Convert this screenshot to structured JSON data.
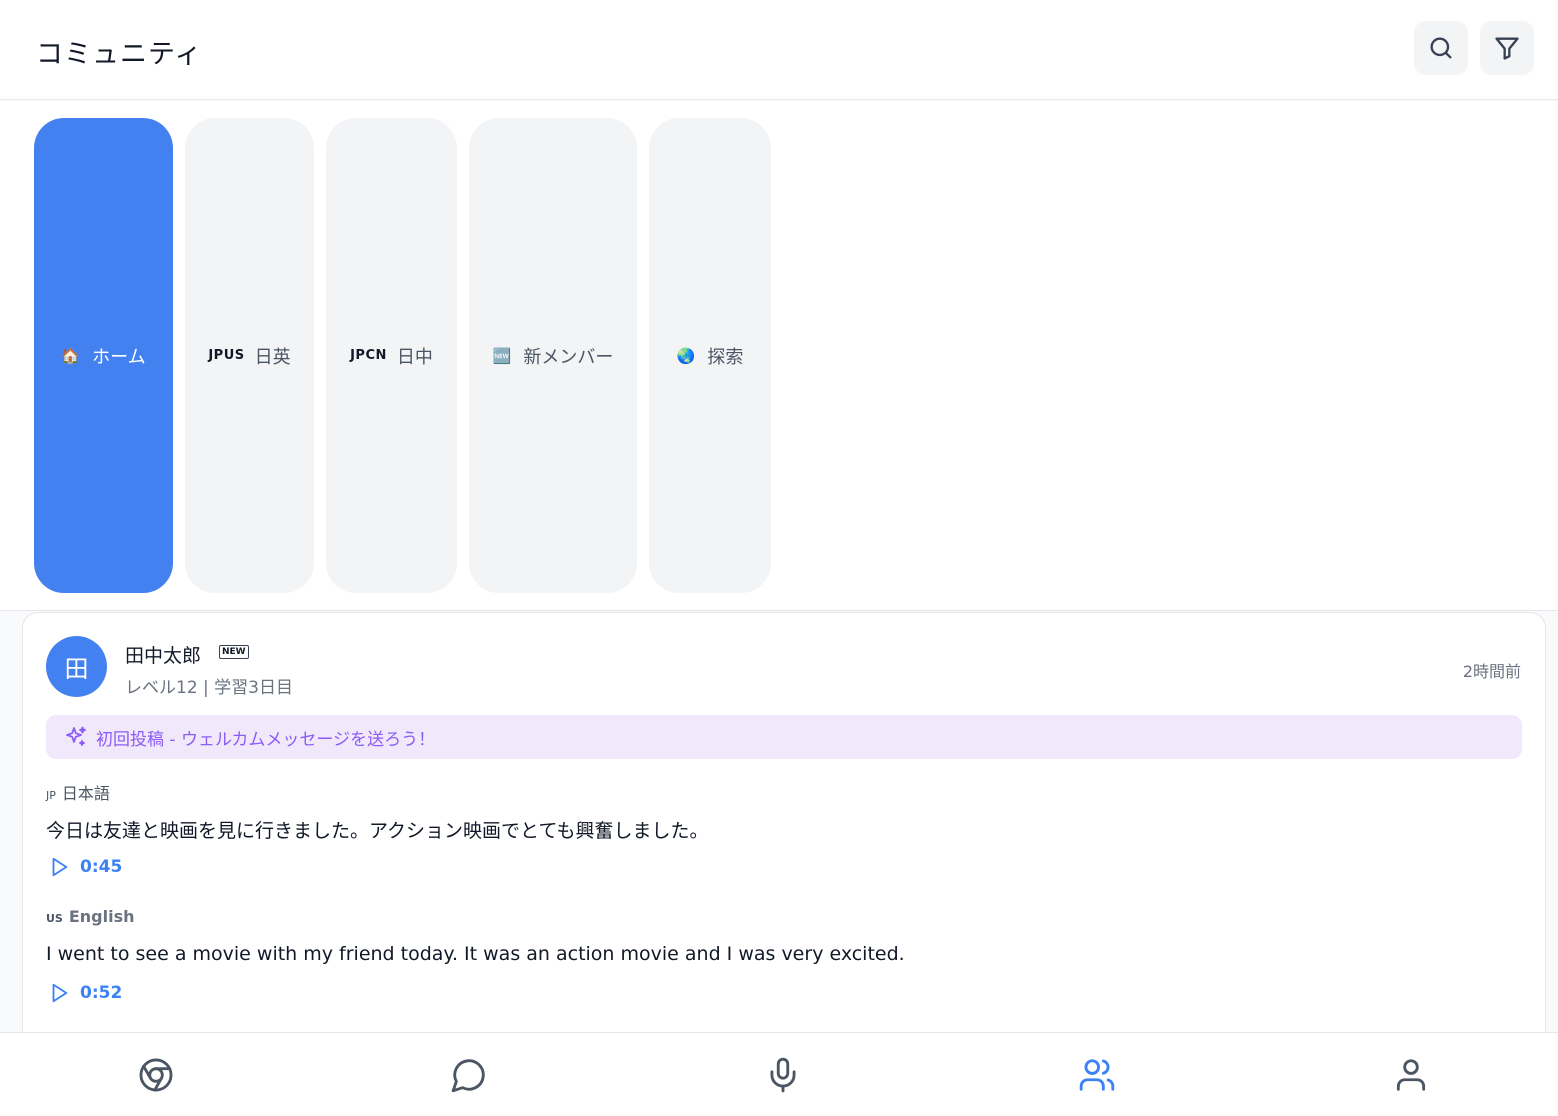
{
  "header": {
    "title": "コミュニティ",
    "search_icon": "search-icon",
    "filter_icon": "filter-icon"
  },
  "tabs": [
    {
      "icon": "🏠",
      "label": "ホーム",
      "active": true
    },
    {
      "icon": "JPUS",
      "label": "日英",
      "active": false
    },
    {
      "icon": "JPCN",
      "label": "日中",
      "active": false
    },
    {
      "icon": "🆕",
      "label": "新メンバー",
      "active": false
    },
    {
      "icon": "🌏",
      "label": "探索",
      "active": false
    }
  ],
  "post": {
    "avatar_text": "田",
    "username": "田中太郎",
    "badge": "NEW",
    "meta": "レベル12 | 学習3日目",
    "time": "2時間前",
    "banner": "初回投稿 - ウェルカムメッセージを送ろう！",
    "japanese": {
      "code": "JP",
      "label": "日本語",
      "text": "今日は友達と映画を見に行きました。アクション映画でとても興奮しました。",
      "duration": "0:45"
    },
    "english": {
      "code": "US",
      "label": "English",
      "text": "I went to see a movie with my friend today. It was an action movie and I was very excited.",
      "duration": "0:52"
    }
  },
  "colors": {
    "accent": "#4381f0",
    "banner_bg": "#f1e8fb",
    "banner_text": "#8b5cf6"
  },
  "nav": [
    {
      "icon": "chrome-icon",
      "active": false
    },
    {
      "icon": "chat-bubble-icon",
      "active": false
    },
    {
      "icon": "microphone-icon",
      "active": false
    },
    {
      "icon": "users-icon",
      "active": true
    },
    {
      "icon": "user-icon",
      "active": false
    }
  ]
}
